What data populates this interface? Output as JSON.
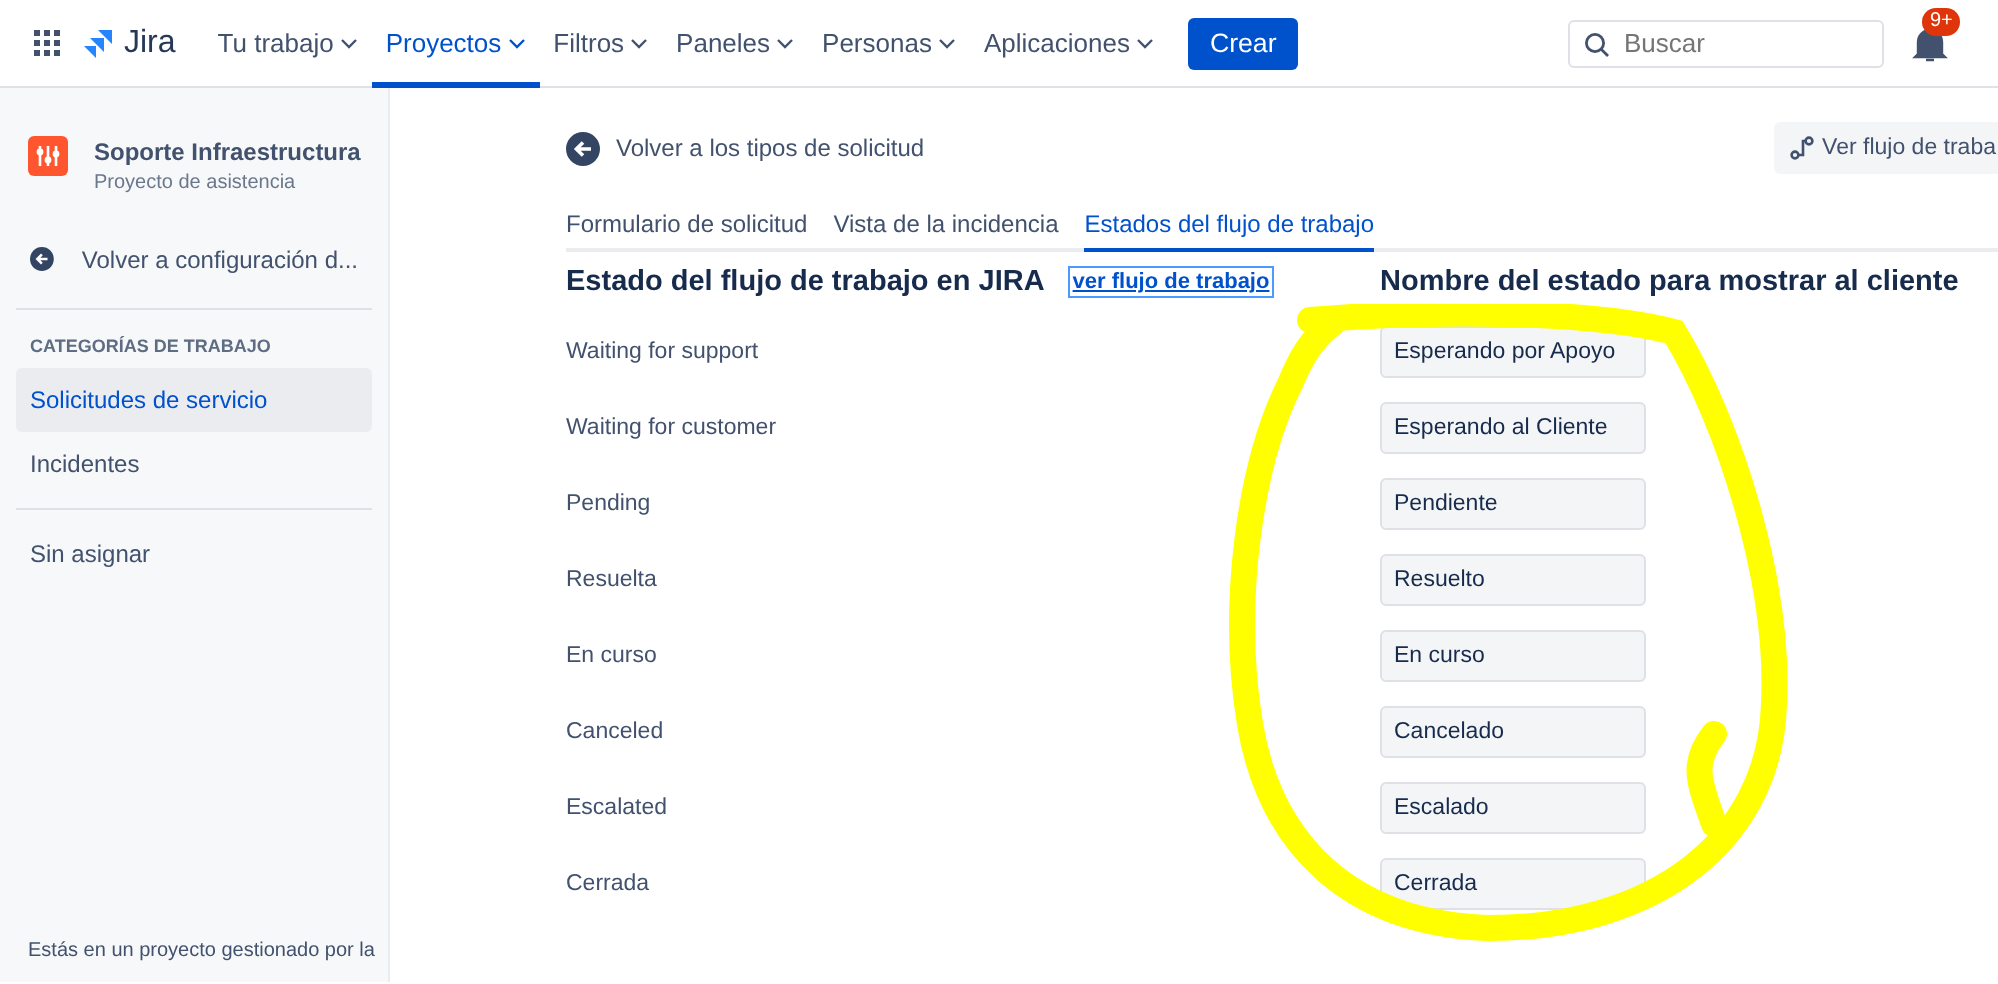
{
  "topbar": {
    "product": "Jira",
    "nav": [
      {
        "label": "Tu trabajo",
        "selected": false
      },
      {
        "label": "Proyectos",
        "selected": true
      },
      {
        "label": "Filtros",
        "selected": false
      },
      {
        "label": "Paneles",
        "selected": false
      },
      {
        "label": "Personas",
        "selected": false
      },
      {
        "label": "Aplicaciones",
        "selected": false
      }
    ],
    "create_button": "Crear",
    "search": {
      "placeholder": "Buscar"
    },
    "notifications_badge": "9+"
  },
  "sidebar": {
    "project_name": "Soporte Infraestructura",
    "project_type": "Proyecto de asistencia",
    "back_link": "Volver a configuración d...",
    "section_heading": "CATEGORÍAS DE TRABAJO",
    "categories": [
      {
        "label": "Solicitudes de servicio",
        "selected": true
      },
      {
        "label": "Incidentes",
        "selected": false
      }
    ],
    "other_items": [
      {
        "label": "Sin asignar",
        "selected": false
      }
    ],
    "footer": "Estás en un proyecto gestionado por la"
  },
  "main": {
    "back_link": "Volver a los tipos de solicitud",
    "workflow_button": "Ver flujo de traba",
    "tabs": [
      {
        "label": "Formulario de solicitud",
        "selected": false
      },
      {
        "label": "Vista de la incidencia",
        "selected": false
      },
      {
        "label": "Estados del flujo de trabajo",
        "selected": true
      }
    ],
    "heading_left": "Estado del flujo de trabajo en JIRA",
    "view_link": "ver flujo de trabajo",
    "heading_right": "Nombre del estado para mostrar al cliente",
    "statuses": [
      {
        "jira": "Waiting for support",
        "customer": "Esperando por Apoyo"
      },
      {
        "jira": "Waiting for customer",
        "customer": "Esperando al Cliente"
      },
      {
        "jira": "Pending",
        "customer": "Pendiente"
      },
      {
        "jira": "Resuelta",
        "customer": "Resuelto"
      },
      {
        "jira": "En curso",
        "customer": "En curso"
      },
      {
        "jira": "Canceled",
        "customer": "Cancelado"
      },
      {
        "jira": "Escalated",
        "customer": "Escalado"
      },
      {
        "jira": "Cerrada",
        "customer": "Cerrada"
      }
    ]
  }
}
